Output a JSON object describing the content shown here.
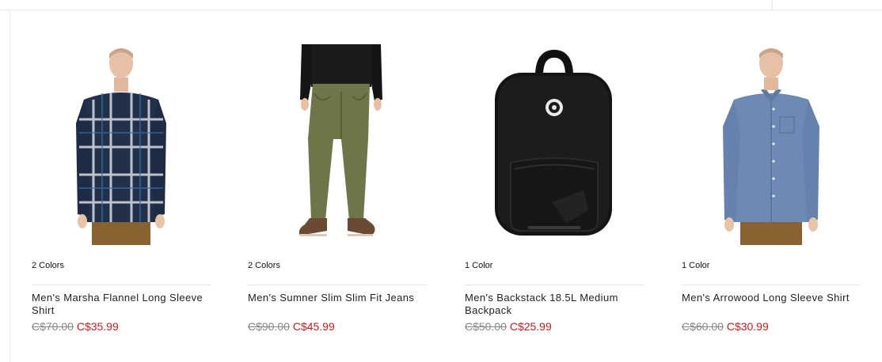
{
  "products": [
    {
      "colors": "2 Colors",
      "title": "Men's Marsha Flannel Long Sleeve Shirt",
      "old_price": "C$70.00",
      "new_price": "C$35.99",
      "image_icon": "flannel-shirt-model"
    },
    {
      "colors": "2 Colors",
      "title": "Men's Sumner Slim Slim Fit Jeans",
      "old_price": "C$90.00",
      "new_price": "C$45.99",
      "image_icon": "green-jeans-model"
    },
    {
      "colors": "1 Color",
      "title": "Men's Backstack 18.5L Medium Backpack",
      "old_price": "C$50.00",
      "new_price": "C$25.99",
      "image_icon": "black-backpack"
    },
    {
      "colors": "1 Color",
      "title": "Men's Arrowood Long Sleeve Shirt",
      "old_price": "C$60.00",
      "new_price": "C$30.99",
      "image_icon": "chambray-shirt-model"
    }
  ],
  "colors": {
    "sale_price": "#c81e1e",
    "old_price": "#888888"
  }
}
